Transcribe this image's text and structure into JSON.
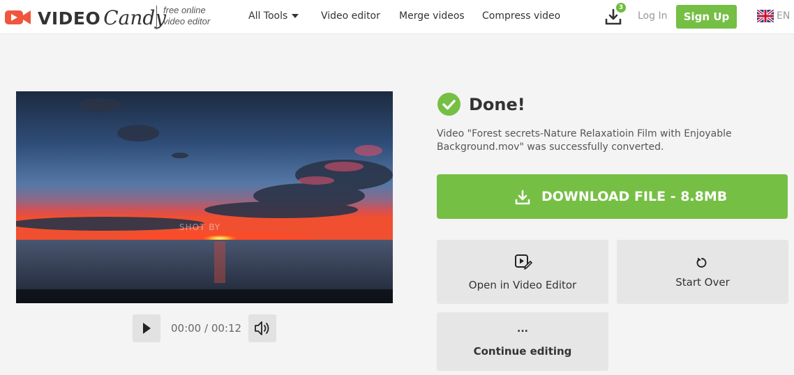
{
  "header": {
    "logo_video": "VIDEO",
    "logo_candy": "Candy",
    "tagline_line1": "free online",
    "tagline_line2": "video editor",
    "nav": {
      "all_tools": "All Tools",
      "video_editor": "Video editor",
      "merge_videos": "Merge videos",
      "compress_video": "Compress video"
    },
    "downloads_badge": "3",
    "login": "Log In",
    "signup": "Sign Up",
    "language": "EN"
  },
  "player": {
    "watermark": "SHOT BY",
    "time": "00:00 / 00:12",
    "play_icon": "play-icon",
    "volume_icon": "volume-icon"
  },
  "result": {
    "title": "Done!",
    "description": "Video \"Forest secrets-Nature Relaxatioin Film with Enjoyable Background.mov\" was successfully converted.",
    "download_label": "DOWNLOAD FILE - 8.8MB",
    "open_editor_label": "Open in Video Editor",
    "start_over_label": "Start Over",
    "continue_dots": "...",
    "continue_label": "Continue editing"
  },
  "colors": {
    "brand_green": "#76bf45",
    "logo_red": "#f0553d",
    "background": "#f4f4f4"
  }
}
